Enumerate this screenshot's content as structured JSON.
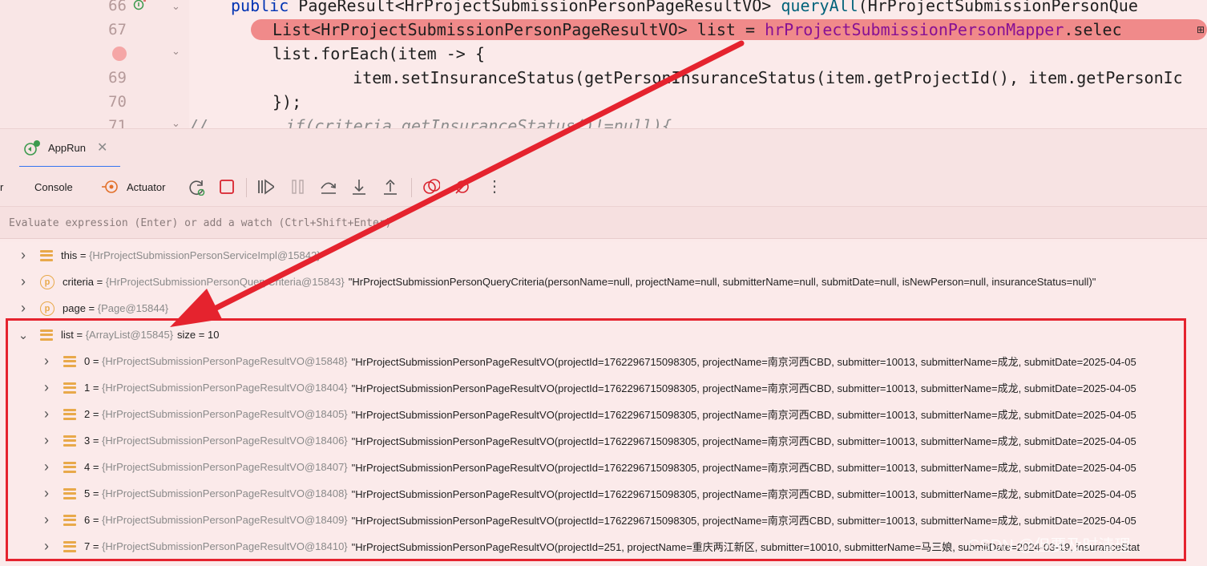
{
  "editor": {
    "lines": [
      {
        "num": "66",
        "code": [
          [
            "kw",
            "public "
          ],
          [
            "",
            "PageResult<HrProjectSubmissionPersonPageResultVO> "
          ],
          [
            "mth",
            "queryAll"
          ],
          [
            "",
            "(HrProjectSubmissionPersonQue"
          ]
        ]
      },
      {
        "num": "67",
        "code": [
          [
            "",
            "List<HrProjectSubmissionPersonPageResultVO> list = "
          ],
          [
            "fld",
            "hrProjectSubmissionPersonMapper"
          ],
          [
            "",
            ".selec"
          ]
        ]
      },
      {
        "num": "",
        "code": [
          [
            "",
            "list.forEach(item -> {"
          ]
        ]
      },
      {
        "num": "69",
        "code": [
          [
            "",
            "    item.setInsuranceStatus(getPersonInsuranceStatus(item.getProjectId(), item.getPersonIc"
          ]
        ]
      },
      {
        "num": "70",
        "code": [
          [
            "",
            "});"
          ]
        ]
      },
      {
        "num": "71",
        "code": [
          [
            "cmt",
            "//        if(criteria.getInsuranceStatus()!=null){"
          ]
        ]
      }
    ]
  },
  "run_tab": {
    "label": "AppRun"
  },
  "toolbar": {
    "console_label": "Console",
    "actuator_label": "Actuator",
    "partial_label": "r"
  },
  "evaluate": {
    "placeholder": "Evaluate expression (Enter) or add a watch (Ctrl+Shift+Enter)"
  },
  "variables": [
    {
      "indent": 0,
      "expanded": false,
      "icon": "field",
      "name": "this",
      "type": "{HrProjectSubmissionPersonServiceImpl@15842}",
      "value": ""
    },
    {
      "indent": 0,
      "expanded": false,
      "icon": "param",
      "name": "criteria",
      "type": "{HrProjectSubmissionPersonQueryCriteria@15843}",
      "value": "\"HrProjectSubmissionPersonQueryCriteria(personName=null, projectName=null, submitterName=null, submitDate=null, isNewPerson=null, insuranceStatus=null)\""
    },
    {
      "indent": 0,
      "expanded": false,
      "icon": "param",
      "name": "page",
      "type": "{Page@15844}",
      "value": ""
    },
    {
      "indent": 0,
      "expanded": true,
      "icon": "field",
      "name": "list",
      "type": "{ArrayList@15845}",
      "value": "size = 10"
    },
    {
      "indent": 1,
      "expanded": false,
      "icon": "field",
      "name": "0",
      "type": "{HrProjectSubmissionPersonPageResultVO@15848}",
      "value": "\"HrProjectSubmissionPersonPageResultVO(projectId=1762296715098305, projectName=南京河西CBD, submitter=10013, submitterName=成龙, submitDate=2025-04-05"
    },
    {
      "indent": 1,
      "expanded": false,
      "icon": "field",
      "name": "1",
      "type": "{HrProjectSubmissionPersonPageResultVO@18404}",
      "value": "\"HrProjectSubmissionPersonPageResultVO(projectId=1762296715098305, projectName=南京河西CBD, submitter=10013, submitterName=成龙, submitDate=2025-04-05"
    },
    {
      "indent": 1,
      "expanded": false,
      "icon": "field",
      "name": "2",
      "type": "{HrProjectSubmissionPersonPageResultVO@18405}",
      "value": "\"HrProjectSubmissionPersonPageResultVO(projectId=1762296715098305, projectName=南京河西CBD, submitter=10013, submitterName=成龙, submitDate=2025-04-05"
    },
    {
      "indent": 1,
      "expanded": false,
      "icon": "field",
      "name": "3",
      "type": "{HrProjectSubmissionPersonPageResultVO@18406}",
      "value": "\"HrProjectSubmissionPersonPageResultVO(projectId=1762296715098305, projectName=南京河西CBD, submitter=10013, submitterName=成龙, submitDate=2025-04-05"
    },
    {
      "indent": 1,
      "expanded": false,
      "icon": "field",
      "name": "4",
      "type": "{HrProjectSubmissionPersonPageResultVO@18407}",
      "value": "\"HrProjectSubmissionPersonPageResultVO(projectId=1762296715098305, projectName=南京河西CBD, submitter=10013, submitterName=成龙, submitDate=2025-04-05"
    },
    {
      "indent": 1,
      "expanded": false,
      "icon": "field",
      "name": "5",
      "type": "{HrProjectSubmissionPersonPageResultVO@18408}",
      "value": "\"HrProjectSubmissionPersonPageResultVO(projectId=1762296715098305, projectName=南京河西CBD, submitter=10013, submitterName=成龙, submitDate=2025-04-05"
    },
    {
      "indent": 1,
      "expanded": false,
      "icon": "field",
      "name": "6",
      "type": "{HrProjectSubmissionPersonPageResultVO@18409}",
      "value": "\"HrProjectSubmissionPersonPageResultVO(projectId=1762296715098305, projectName=南京河西CBD, submitter=10013, submitterName=成龙, submitDate=2025-04-05"
    },
    {
      "indent": 1,
      "expanded": false,
      "icon": "field",
      "name": "7",
      "type": "{HrProjectSubmissionPersonPageResultVO@18410}",
      "value": "\"HrProjectSubmissionPersonPageResultVO(projectId=251, projectName=重庆两江新区, submitter=10010, submitterName=马三娘, submitDate=2024-03-19, insuranceStat"
    }
  ],
  "watermark": "CSDN @但要及时清理",
  "colors": {
    "annotation_red": "#e5232e",
    "highlight_line": "#f08a8a",
    "accent_blue": "#3574f0",
    "icon_orange": "#e8a94a"
  }
}
